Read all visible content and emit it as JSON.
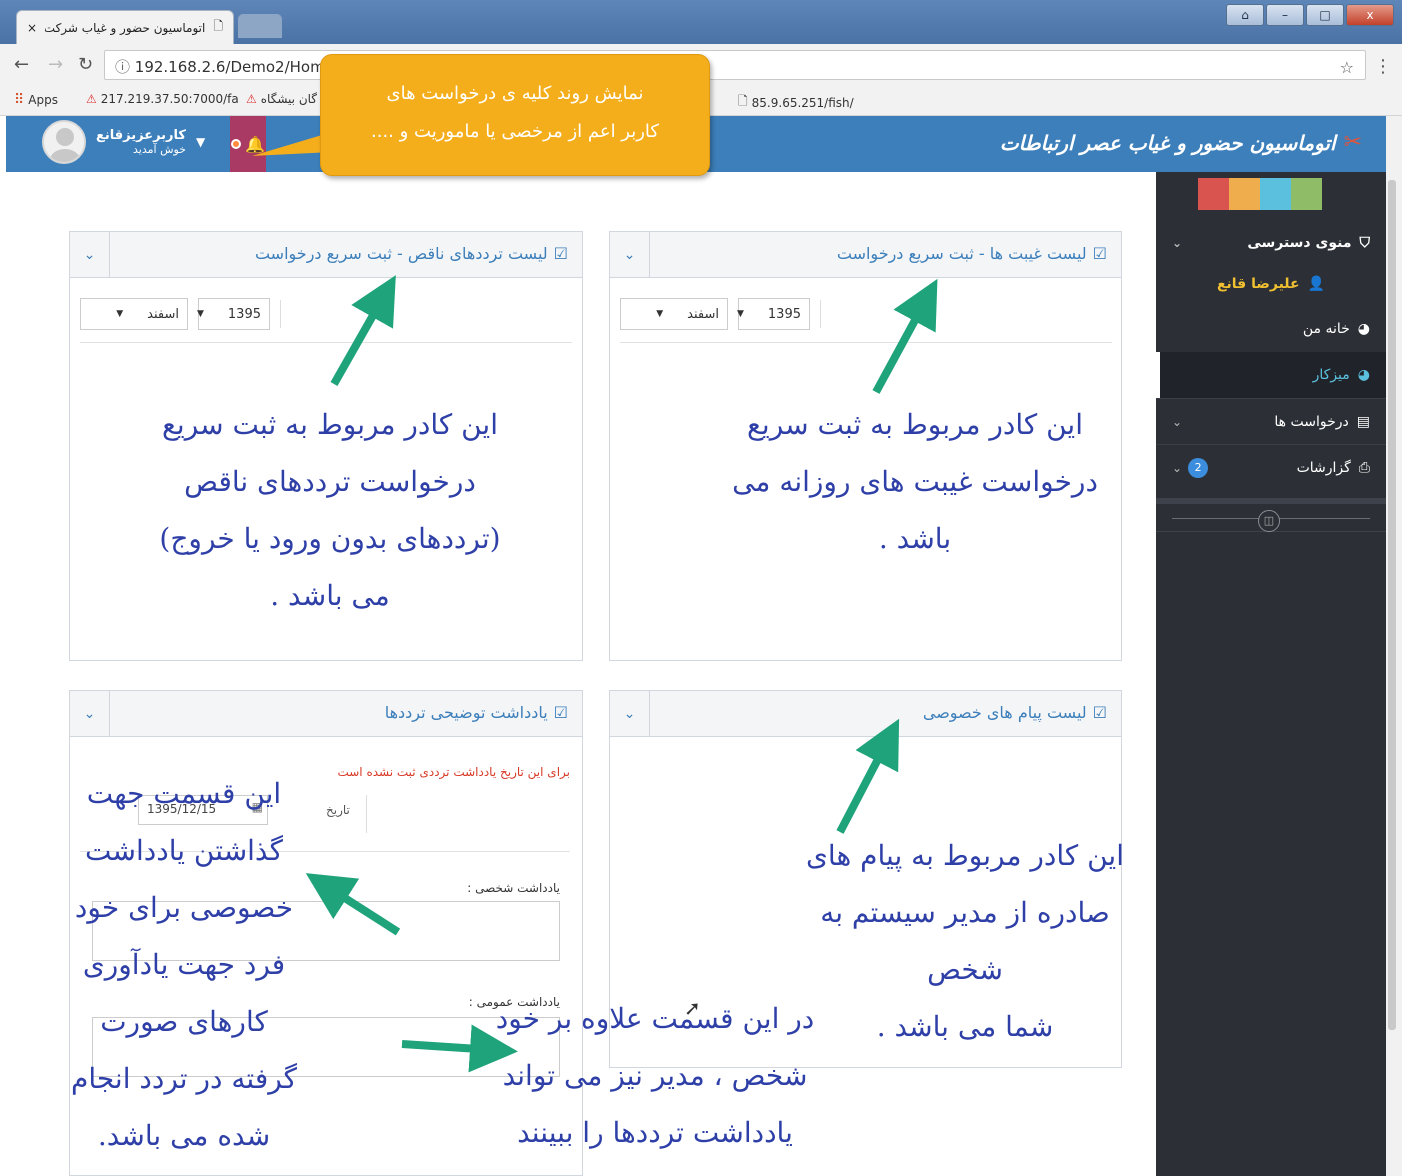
{
  "browser": {
    "tab_title": "اتوماسیون حضور و غیاب شرکت",
    "tab_close": "×",
    "window_buttons": [
      "⌂",
      "–",
      "□",
      "x"
    ],
    "url": "192.168.2.6/Demo2/Home",
    "bookmarks": [
      {
        "label": "Apps",
        "icon": "apps-grid-icon"
      },
      {
        "label": "217.219.37.50:7000/fa",
        "icon": "site-logo-icon"
      },
      {
        "label": "گان بیشگاه",
        "icon": "site-logo-icon"
      },
      {
        "label": "85.9.65.251/fish/",
        "icon": "page-icon"
      }
    ]
  },
  "header": {
    "brand": "اتوماسیون حضور و غیاب عصر ارتباطات",
    "user_name": "کاربرعزیزقانع",
    "user_welcome": "خوش آمدید"
  },
  "callout": {
    "line1": "نمایش روند کلیه ی درخواست های",
    "line2": "کاربر اعم از مرخصی یا ماموریت و ...."
  },
  "sidebar": {
    "swatch_colors": [
      "#d9534f",
      "#f0ad4e",
      "#5bc0de",
      "#8fbc66"
    ],
    "menu_title": "منوی دسترسی",
    "user": "علیرضا قانع",
    "items": [
      {
        "label": "خانه من",
        "icon": "palette-icon"
      },
      {
        "label": "میزکار",
        "icon": "palette-icon"
      },
      {
        "label": "درخواست ها",
        "icon": "list-icon"
      },
      {
        "label": "گزارشات",
        "icon": "printer-icon",
        "badge": "2"
      }
    ]
  },
  "panels": {
    "absence": {
      "title": "لیست غیبت ها - ثبت سریع درخواست",
      "year": "1395",
      "month": "اسفند",
      "note": [
        "این کادر مربوط به ثبت سریع",
        "درخواست غیبت های روزانه می",
        "باشد ."
      ]
    },
    "incomplete": {
      "title": "لیست ترددهای ناقص - ثبت سریع درخواست",
      "year": "1395",
      "month": "اسفند",
      "note": [
        "این کادر مربوط به ثبت سریع",
        "درخواست ترددهای ناقص",
        "(ترددهای بدون ورود یا خروج)",
        "می باشد ."
      ]
    },
    "messages": {
      "title": "لیست پیام های خصوصی",
      "note": [
        "این کادر مربوط به پیام های",
        "صادره از مدیر سیستم به شخص",
        "شما می باشد ."
      ]
    },
    "notes": {
      "title": "یادداشت توضیحی ترددها",
      "warning": "برای این تاریخ یادداشت ترددی ثبت نشده است",
      "date_label": "تاریخ",
      "date_value": "1395/12/15",
      "personal_label": "یادداشت شخصی :",
      "public_label": "یادداشت عمومی :",
      "note_left": [
        "این قسمت جهت",
        "گذاشتن یادداشت",
        "خصوصی برای خود",
        "فرد جهت یادآوری",
        "کارهای صورت",
        "گرفته در تردد انجام",
        "شده می باشد."
      ],
      "note_right": [
        "در این قسمت علاوه بر خود",
        "شخص ، مدیر نیز می تواند",
        "یادداشت ترددها را ببینند"
      ]
    }
  }
}
